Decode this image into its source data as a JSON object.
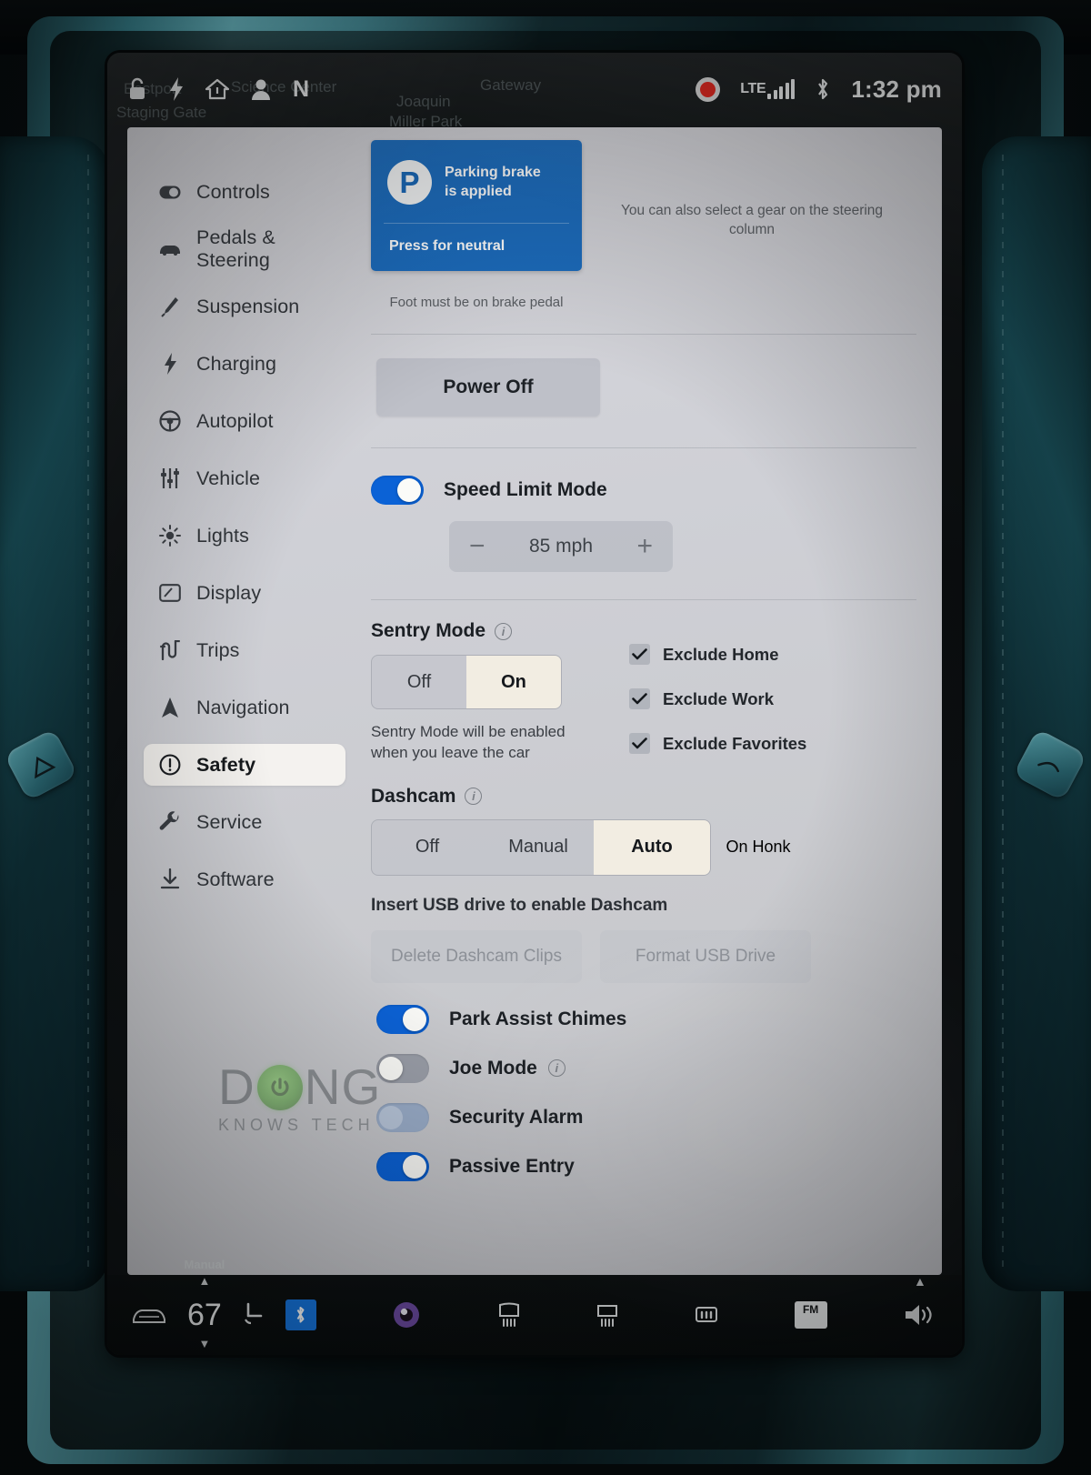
{
  "status_bar": {
    "icons_left": [
      "lock-icon",
      "bolt-icon",
      "home-icon",
      "person-icon"
    ],
    "gear_indicator": "N",
    "icons_right": [
      "record-icon",
      "lte-signal-icon",
      "bluetooth-icon"
    ],
    "lte_label": "LTE",
    "time": "1:32 pm",
    "map_ghost": {
      "l1": "Eastport",
      "l2": "Staging Gate",
      "l3": "Science Center",
      "l4": "Joaquin",
      "l5": "Miller Park",
      "l6": "Gateway"
    }
  },
  "sidebar": {
    "items": [
      {
        "label": "Controls",
        "icon": "toggle-icon",
        "active": false
      },
      {
        "label": "Pedals & Steering",
        "icon": "car-icon",
        "active": false
      },
      {
        "label": "Suspension",
        "icon": "shock-icon",
        "active": false
      },
      {
        "label": "Charging",
        "icon": "bolt-icon",
        "active": false
      },
      {
        "label": "Autopilot",
        "icon": "steering-icon",
        "active": false
      },
      {
        "label": "Vehicle",
        "icon": "sliders-icon",
        "active": false
      },
      {
        "label": "Lights",
        "icon": "sun-icon",
        "active": false
      },
      {
        "label": "Display",
        "icon": "screen-icon",
        "active": false
      },
      {
        "label": "Trips",
        "icon": "road-icon",
        "active": false
      },
      {
        "label": "Navigation",
        "icon": "navarrow-icon",
        "active": false
      },
      {
        "label": "Safety",
        "icon": "warning-icon",
        "active": true
      },
      {
        "label": "Service",
        "icon": "wrench-icon",
        "active": false
      },
      {
        "label": "Software",
        "icon": "download-icon",
        "active": false
      }
    ]
  },
  "gear_card": {
    "badge": "P",
    "status_line1": "Parking brake",
    "status_line2": "is applied",
    "neutral_action": "Press for neutral",
    "side_note": "You can also select a gear on the steering column",
    "foot_note": "Foot must be on brake pedal"
  },
  "power_off": {
    "label": "Power Off"
  },
  "speed_limit": {
    "label": "Speed Limit Mode",
    "enabled": true,
    "minus": "−",
    "plus": "+",
    "value": "85 mph"
  },
  "sentry_mode": {
    "title": "Sentry Mode",
    "info_icon": "info-icon",
    "options": [
      "Off",
      "On"
    ],
    "selected": "On",
    "note_line1": "Sentry Mode will be enabled",
    "note_line2": "when you leave the car",
    "exclusions": [
      {
        "label": "Exclude Home",
        "checked": true
      },
      {
        "label": "Exclude Work",
        "checked": true
      },
      {
        "label": "Exclude Favorites",
        "checked": true
      }
    ]
  },
  "dashcam": {
    "title": "Dashcam",
    "info_icon": "info-icon",
    "options": [
      "Off",
      "Manual",
      "Auto",
      "On Honk"
    ],
    "selected": "Auto",
    "highlighted": "On Honk",
    "usb_note": "Insert USB drive to enable Dashcam",
    "buttons": [
      "Delete Dashcam Clips",
      "Format USB Drive"
    ]
  },
  "switch_rows": [
    {
      "label": "Park Assist Chimes",
      "state": "on",
      "info": false
    },
    {
      "label": "Joe Mode",
      "state": "off",
      "info": true
    },
    {
      "label": "Security Alarm",
      "state": "dim",
      "info": false
    },
    {
      "label": "Passive Entry",
      "state": "on",
      "info": false
    }
  ],
  "dock": {
    "items": [
      {
        "name": "car-icon"
      },
      {
        "name": "climate-temp",
        "mode": "Manual",
        "temp": "67"
      },
      {
        "name": "seat-heater-icon"
      },
      {
        "name": "bluetooth-icon"
      },
      {
        "name": "media-icon"
      },
      {
        "name": "defrost-rear-icon"
      },
      {
        "name": "defrost-front-icon"
      },
      {
        "name": "seat-vent-icon"
      },
      {
        "name": "fm-radio-icon",
        "label": "FM"
      },
      {
        "name": "volume-icon"
      }
    ]
  },
  "watermark": {
    "d": "D",
    "ng": "NG",
    "sub": "KNOWS TECH"
  },
  "colors": {
    "accent_blue": "#0b62d6",
    "gear_card_blue": "#1c6cbd",
    "selected_cream": "#f2ede2",
    "panel_gray": "#cfd0d6",
    "trim_teal": "#4ba3b0"
  }
}
